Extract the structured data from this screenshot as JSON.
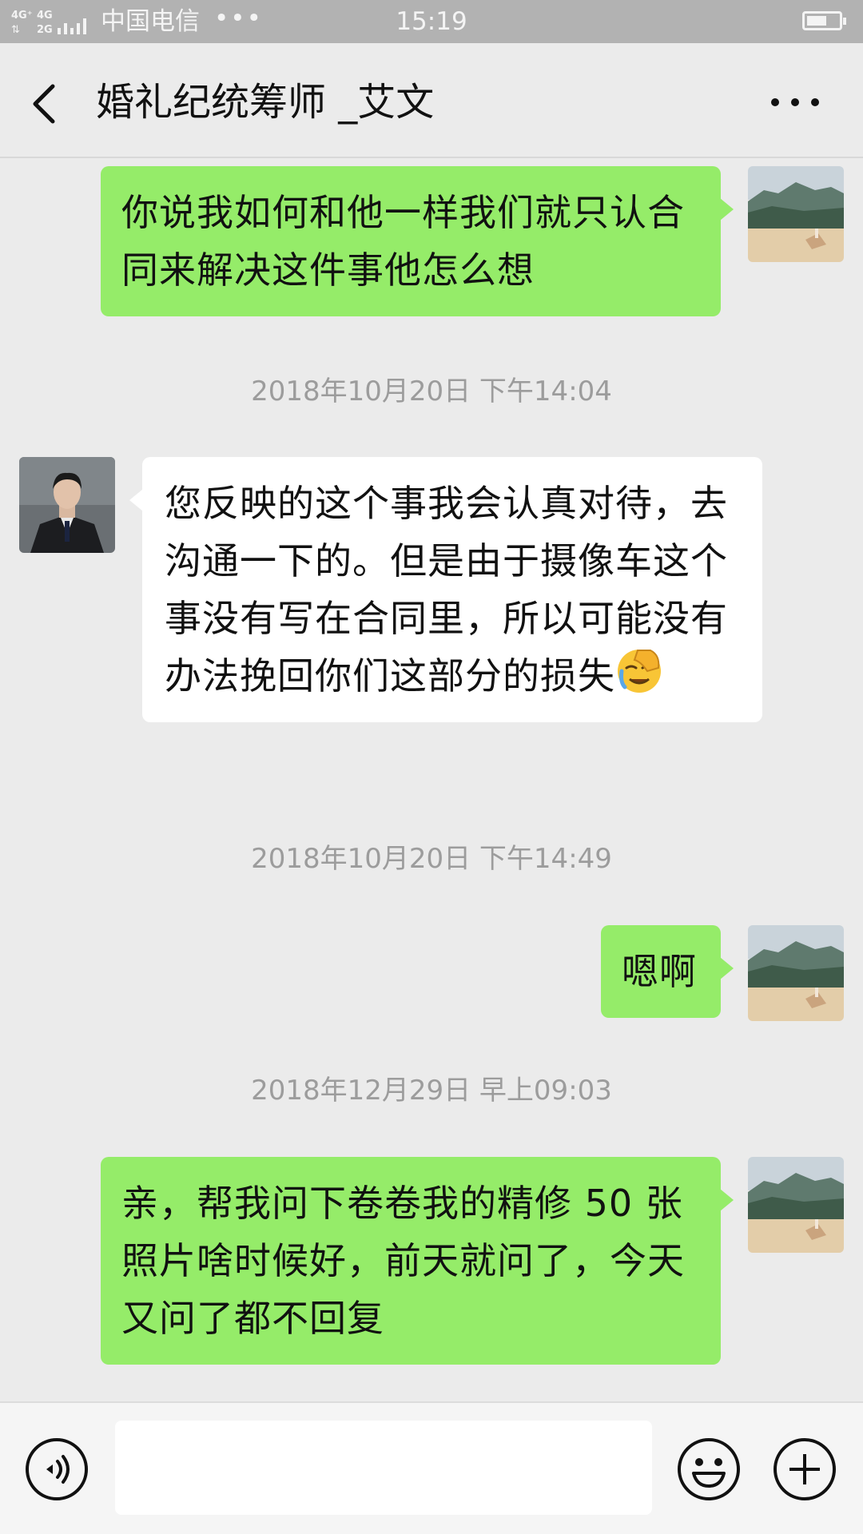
{
  "status_bar": {
    "carrier": "中国电信",
    "dots": "•••",
    "time": "15:19",
    "signal_top": "4G⁺ 4G",
    "signal_bottom": "2G",
    "battery_level": 0.6
  },
  "header": {
    "title": "婚礼纪统筹师 _艾文",
    "back_icon": "chevron-left-icon",
    "more_icon": "more-horizontal-icon"
  },
  "messages": [
    {
      "sender": "me",
      "text": "你说我如何和他一样我们就只认合同来解决这件事他怎么想"
    },
    {
      "type": "timestamp",
      "text": "2018年10月20日 下午14:04"
    },
    {
      "sender": "other",
      "text": "您反映的这个事我会认真对待，去沟通一下的。但是由于摄像车这个事没有写在合同里，所以可能没有办法挽回你们这部分的损失",
      "emoji": "face-palm-crying-emoji"
    },
    {
      "type": "timestamp",
      "text": "2018年10月20日 下午14:49"
    },
    {
      "sender": "me",
      "text": "嗯啊"
    },
    {
      "type": "timestamp",
      "text": "2018年12月29日 早上09:03"
    },
    {
      "sender": "me",
      "text": "亲，帮我问下卷卷我的精修 50 张照片啥时候好，前天就问了，今天又问了都不回复"
    }
  ],
  "input_bar": {
    "placeholder": "",
    "voice_icon": "voice-icon",
    "emoji_icon": "smiley-icon",
    "plus_icon": "plus-circle-icon"
  },
  "colors": {
    "my_bubble": "#95ec69",
    "their_bubble": "#ffffff",
    "chat_background": "#ebebeb",
    "status_bar": "#b2b2b2"
  }
}
